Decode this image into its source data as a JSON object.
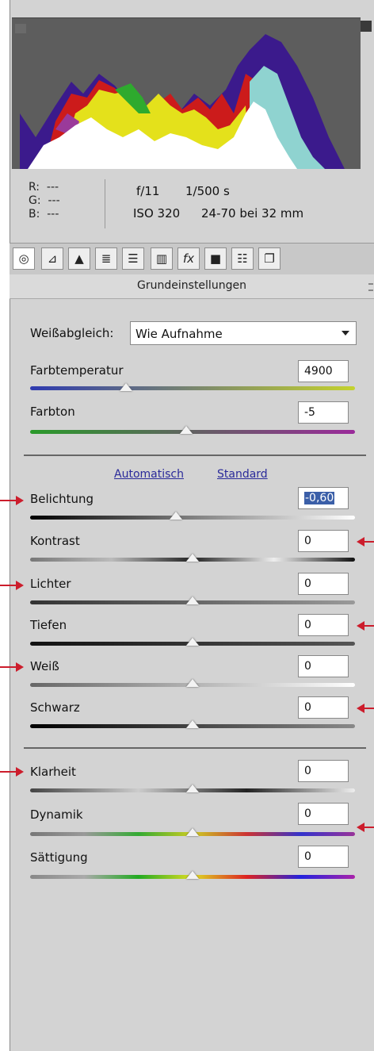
{
  "info": {
    "r_label": "R:",
    "r_value": "---",
    "g_label": "G:",
    "g_value": "---",
    "b_label": "B:",
    "b_value": "---",
    "aperture": "f/11",
    "shutter": "1/500 s",
    "iso": "ISO 320",
    "lens": "24-70 bei 32 mm"
  },
  "tabs": [
    "aperture-icon",
    "tone-curve-icon",
    "detail-icon",
    "hsl-icon",
    "split-toning-icon",
    "lens-icon",
    "fx-icon",
    "camera-icon",
    "presets-icon",
    "snapshots-icon"
  ],
  "section": {
    "title": "Grundeinstellungen"
  },
  "white_balance": {
    "label": "Weißabgleich:",
    "value": "Wie Aufnahme"
  },
  "sliders_top": [
    {
      "label": "Farbtemperatur",
      "value": "4900",
      "level": 0.3
    },
    {
      "label": "Farbton",
      "value": "-5",
      "level": 0.48
    }
  ],
  "links": {
    "auto": "Automatisch",
    "default": "Standard"
  },
  "sliders_tone": [
    {
      "label": "Belichtung",
      "value": "-0,60",
      "level": 0.45
    },
    {
      "label": "Kontrast",
      "value": "0",
      "level": 0.5
    },
    {
      "label": "Lichter",
      "value": "0",
      "level": 0.5
    },
    {
      "label": "Tiefen",
      "value": "0",
      "level": 0.5
    },
    {
      "label": "Weiß",
      "value": "0",
      "level": 0.5
    },
    {
      "label": "Schwarz",
      "value": "0",
      "level": 0.5
    }
  ],
  "sliders_presence": [
    {
      "label": "Klarheit",
      "value": "0",
      "level": 0.5
    },
    {
      "label": "Dynamik",
      "value": "0",
      "level": 0.5
    },
    {
      "label": "Sättigung",
      "value": "0",
      "level": 0.5
    }
  ],
  "colors": {
    "annotation_arrow": "#cc1d2c",
    "panel_bg": "#d3d3d3",
    "histogram_bg": "#5d5d5d",
    "selected_field": "#3b5fa8"
  }
}
